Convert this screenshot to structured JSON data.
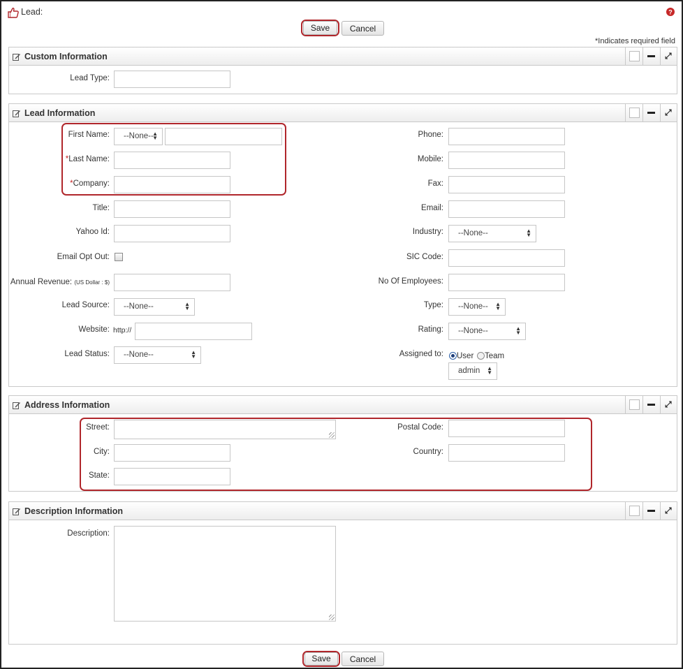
{
  "page": {
    "title": "Lead:",
    "required_note": "*Indicates required field",
    "save_label": "Save",
    "cancel_label": "Cancel",
    "colors": {
      "accent": "#b0262b",
      "border": "#c9c9c9"
    }
  },
  "sections": {
    "custom": {
      "title": "Custom Information",
      "lead_type_label": "Lead Type:"
    },
    "lead": {
      "title": "Lead Information",
      "first_name_label": "First Name:",
      "salutation_value": "--None--",
      "last_name_label": "Last Name:",
      "company_label": "Company:",
      "title_label": "Title:",
      "yahoo_label": "Yahoo Id:",
      "email_opt_out_label": "Email Opt Out:",
      "annual_revenue_label": "Annual Revenue:",
      "annual_revenue_unit": "(US Dollar : $)",
      "lead_source_label": "Lead Source:",
      "lead_source_value": "--None--",
      "website_label": "Website:",
      "website_prefix": "http://",
      "lead_status_label": "Lead Status:",
      "lead_status_value": "--None--",
      "phone_label": "Phone:",
      "mobile_label": "Mobile:",
      "fax_label": "Fax:",
      "email_label": "Email:",
      "industry_label": "Industry:",
      "industry_value": "--None--",
      "sic_label": "SIC Code:",
      "employees_label": "No Of Employees:",
      "type_label": "Type:",
      "type_value": "--None--",
      "rating_label": "Rating:",
      "rating_value": "--None--",
      "assigned_label": "Assigned to:",
      "assigned_user_label": "User",
      "assigned_team_label": "Team",
      "assigned_value": "admin"
    },
    "address": {
      "title": "Address Information",
      "street_label": "Street:",
      "city_label": "City:",
      "state_label": "State:",
      "postal_label": "Postal Code:",
      "country_label": "Country:"
    },
    "description": {
      "title": "Description Information",
      "description_label": "Description:"
    }
  }
}
